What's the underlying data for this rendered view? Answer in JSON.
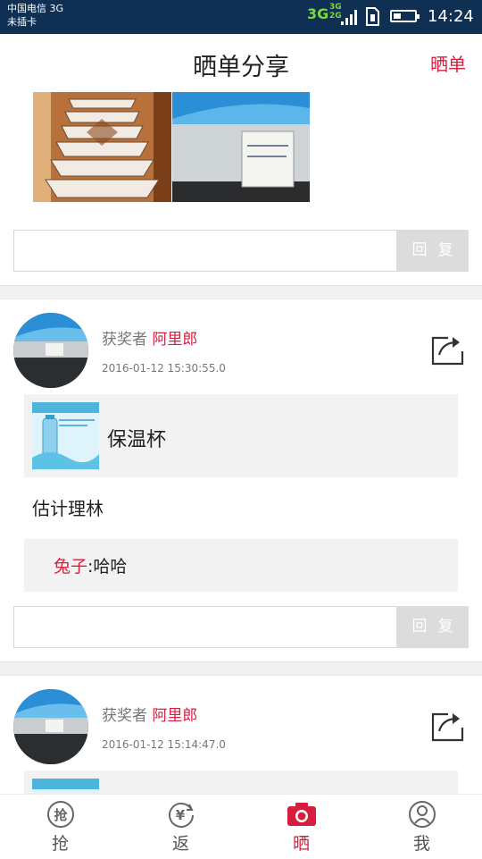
{
  "status_bar": {
    "carrier_line1": "中国电信 3G",
    "carrier_line2": "未插卡",
    "network_main": "3G",
    "network_small_top": "3G",
    "network_small_bottom": "2G",
    "time": "14:24",
    "battery_level": 0.35
  },
  "header": {
    "title": "晒单分享",
    "action_label": "晒单"
  },
  "reply_button_label": "回复",
  "posts": [
    {
      "winner_prefix": "获奖者",
      "winner_name": "阿里郎",
      "time": "2016-01-12 15:30:55.0",
      "product_name": "保温杯",
      "text": "估计理林",
      "comment_author": "兔子",
      "comment_text": ":哈哈"
    },
    {
      "winner_prefix": "获奖者",
      "winner_name": "阿里郎",
      "time": "2016-01-12 15:14:47.0"
    }
  ],
  "tabs": [
    {
      "label": "抢",
      "icon": "grab-icon",
      "active": false
    },
    {
      "label": "返",
      "icon": "yen-refund-icon",
      "active": false
    },
    {
      "label": "晒",
      "icon": "camera-icon",
      "active": true
    },
    {
      "label": "我",
      "icon": "user-icon",
      "active": false
    }
  ],
  "colors": {
    "accent": "#d81e3f",
    "status_bar": "#0f2f53"
  }
}
